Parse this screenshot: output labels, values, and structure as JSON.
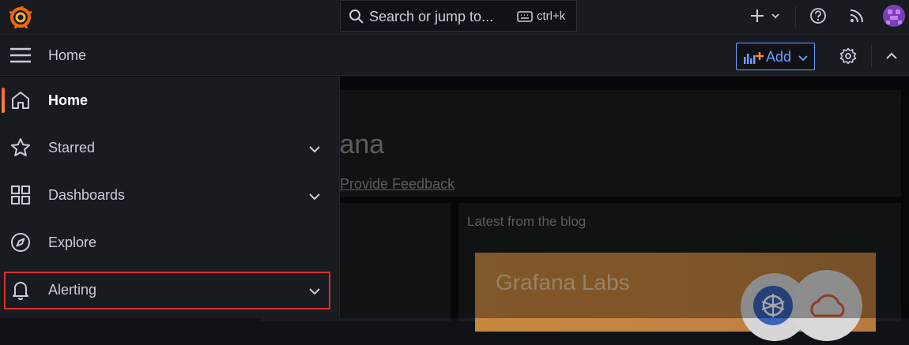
{
  "topbar": {
    "search_text": "Search or jump to...",
    "shortcut": "ctrl+k"
  },
  "subbar": {
    "breadcrumb": "Home",
    "add_label": "Add"
  },
  "sidebar": {
    "items": [
      {
        "label": "Home",
        "icon": "home-icon",
        "active": true
      },
      {
        "label": "Starred",
        "icon": "star-icon",
        "expandable": true
      },
      {
        "label": "Dashboards",
        "icon": "grid-icon",
        "expandable": true
      },
      {
        "label": "Explore",
        "icon": "compass-icon"
      },
      {
        "label": "Alerting",
        "icon": "bell-icon",
        "expandable": true,
        "highlighted": true
      }
    ]
  },
  "main": {
    "welcome_title": "fana",
    "feedback_link": "Provide Feedback",
    "blog_title": "Latest from the blog",
    "blog_image_text": "Grafana Labs"
  },
  "colors": {
    "accent": "#6e9fff",
    "active_indicator": "#f55f3e",
    "highlight_border": "#e02f2f"
  }
}
